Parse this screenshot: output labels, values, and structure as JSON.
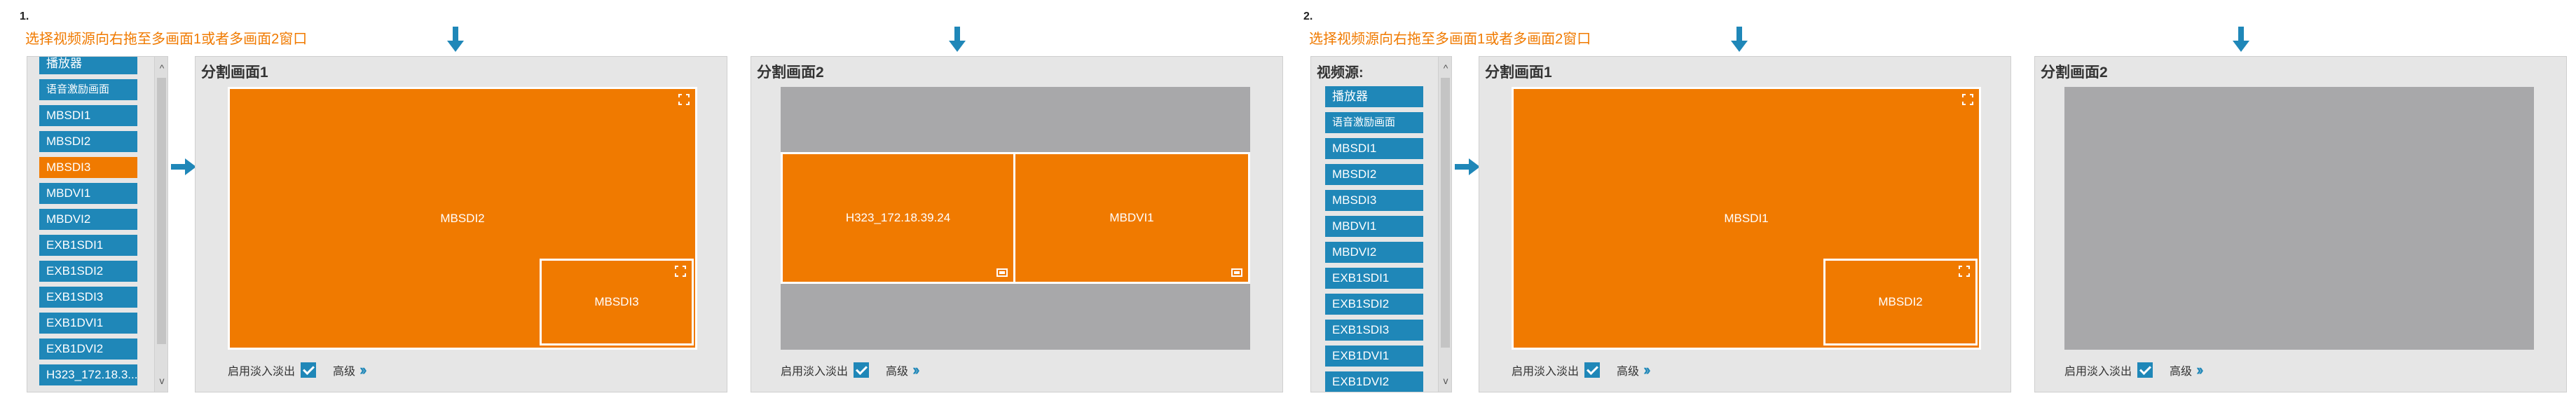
{
  "steps": [
    {
      "number": "1.",
      "instruction": "选择视频源向右拖至多画面1或者多画面2窗口",
      "source_panel": {
        "title": "",
        "items": [
          "播放器",
          "语音激励画面",
          "MBSDI1",
          "MBSDI2",
          "MBSDI3",
          "MBDVI1",
          "MBDVI2",
          "EXB1SDI1",
          "EXB1SDI2",
          "EXB1SDI3",
          "EXB1DVI1",
          "EXB1DVI2",
          "H323_172.18.3..."
        ],
        "active_item": "MBSDI3",
        "scroll_up": "^",
        "scroll_down": "v"
      },
      "split1": {
        "title": "分割画面1",
        "main_tile": "MBSDI2",
        "pip_tile": "MBSDI3",
        "fade_label": "启用淡入淡出",
        "advanced_label": "高级"
      },
      "split2": {
        "title": "分割画面2",
        "left_tile": "H323_172.18.39.24",
        "right_tile": "MBDVI1",
        "fade_label": "启用淡入淡出",
        "advanced_label": "高级"
      }
    },
    {
      "number": "2.",
      "instruction": "选择视频源向右拖至多画面1或者多画面2窗口",
      "source_panel": {
        "title": "视频源:",
        "items": [
          "播放器",
          "语音激励画面",
          "MBSDI1",
          "MBSDI2",
          "MBSDI3",
          "MBDVI1",
          "MBDVI2",
          "EXB1SDI1",
          "EXB1SDI2",
          "EXB1SDI3",
          "EXB1DVI1",
          "EXB1DVI2"
        ],
        "active_item": "",
        "scroll_up": "^",
        "scroll_down": "v"
      },
      "split1": {
        "title": "分割画面1",
        "main_tile": "MBSDI1",
        "pip_tile": "MBSDI2",
        "fade_label": "启用淡入淡出",
        "advanced_label": "高级"
      },
      "split2": {
        "title": "分割画面2",
        "fade_label": "启用淡入淡出",
        "advanced_label": "高级"
      }
    }
  ],
  "colors": {
    "accent_orange": "#f07a00",
    "accent_blue": "#1f87b8",
    "panel_bg": "#e6e6e6",
    "empty_canvas": "#a8a8aa"
  },
  "icons": [
    "arrow-down-icon",
    "arrow-right-icon",
    "expand-icon",
    "screen-icon",
    "checkbox-checked-icon",
    "double-chevron-right-icon"
  ]
}
